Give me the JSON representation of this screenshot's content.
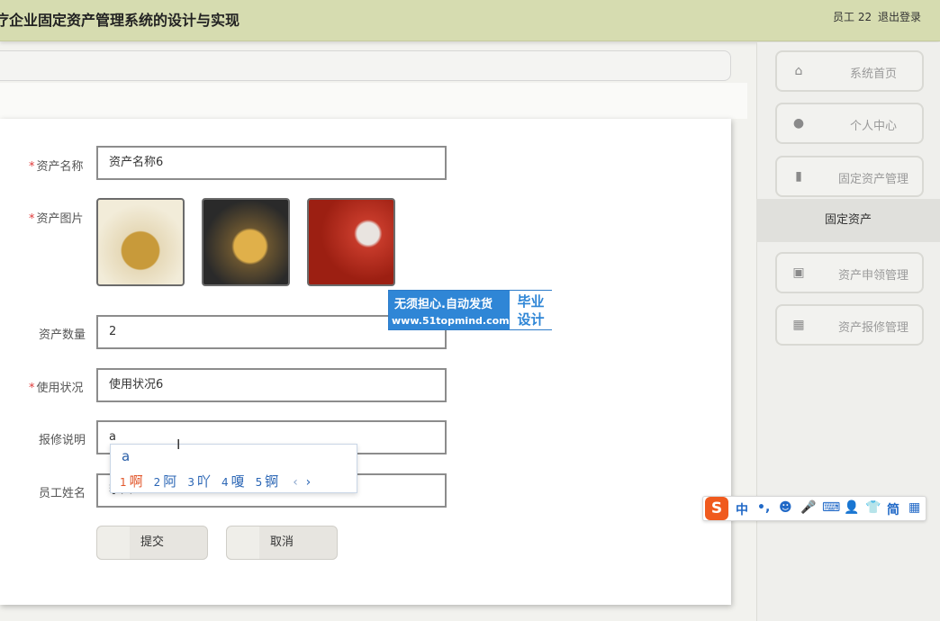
{
  "header": {
    "title": "疗企业固定资产管理系统的设计与实现",
    "user": "员工 22",
    "logout": "退出登录"
  },
  "form": {
    "name": {
      "label": "资产名称",
      "required": true,
      "value": "资产名称6"
    },
    "images": {
      "label": "资产图片",
      "required": true
    },
    "quantity": {
      "label": "资产数量",
      "required": false,
      "value": "2"
    },
    "status": {
      "label": "使用状况",
      "required": true,
      "value": "使用状况6"
    },
    "repair": {
      "label": "报修说明",
      "required": false,
      "value": "a"
    },
    "employee": {
      "label": "员工姓名",
      "required": false,
      "value": "李四"
    },
    "submit": "提交",
    "cancel": "取消"
  },
  "ime": {
    "composition": "a",
    "candidates": [
      {
        "num": "1",
        "text": "啊"
      },
      {
        "num": "2",
        "text": "阿"
      },
      {
        "num": "3",
        "text": "吖"
      },
      {
        "num": "4",
        "text": "嗄"
      },
      {
        "num": "5",
        "text": "锕"
      }
    ],
    "nav_prev": "‹",
    "nav_next": "›"
  },
  "watermark": {
    "line1": "无须担心.自动发货",
    "line2": "www.51topmind.com",
    "side1": "毕业",
    "side2": "设计"
  },
  "sidebar": {
    "items": [
      {
        "label": "系统首页",
        "icon": "home-icon"
      },
      {
        "label": "个人中心",
        "icon": "user-icon"
      },
      {
        "label": "固定资产管理",
        "icon": "book-icon"
      },
      {
        "label": "资产申领管理",
        "icon": "clipboard-icon"
      },
      {
        "label": "资产报修管理",
        "icon": "grid-icon"
      }
    ],
    "active_sub": "固定资产"
  },
  "sogou": {
    "logo": "S",
    "items": [
      "中",
      "•,",
      "☻",
      "🎤",
      "⌨",
      "👤",
      "👕",
      "简",
      "▦"
    ]
  },
  "colors": {
    "header_bg": "#d6dcb0",
    "required": "#e03c3c",
    "ime_selected": "#e2562a",
    "ime_candidate": "#2b66b5",
    "watermark": "#2f86d6",
    "sogou_logo": "#f05a1e"
  }
}
